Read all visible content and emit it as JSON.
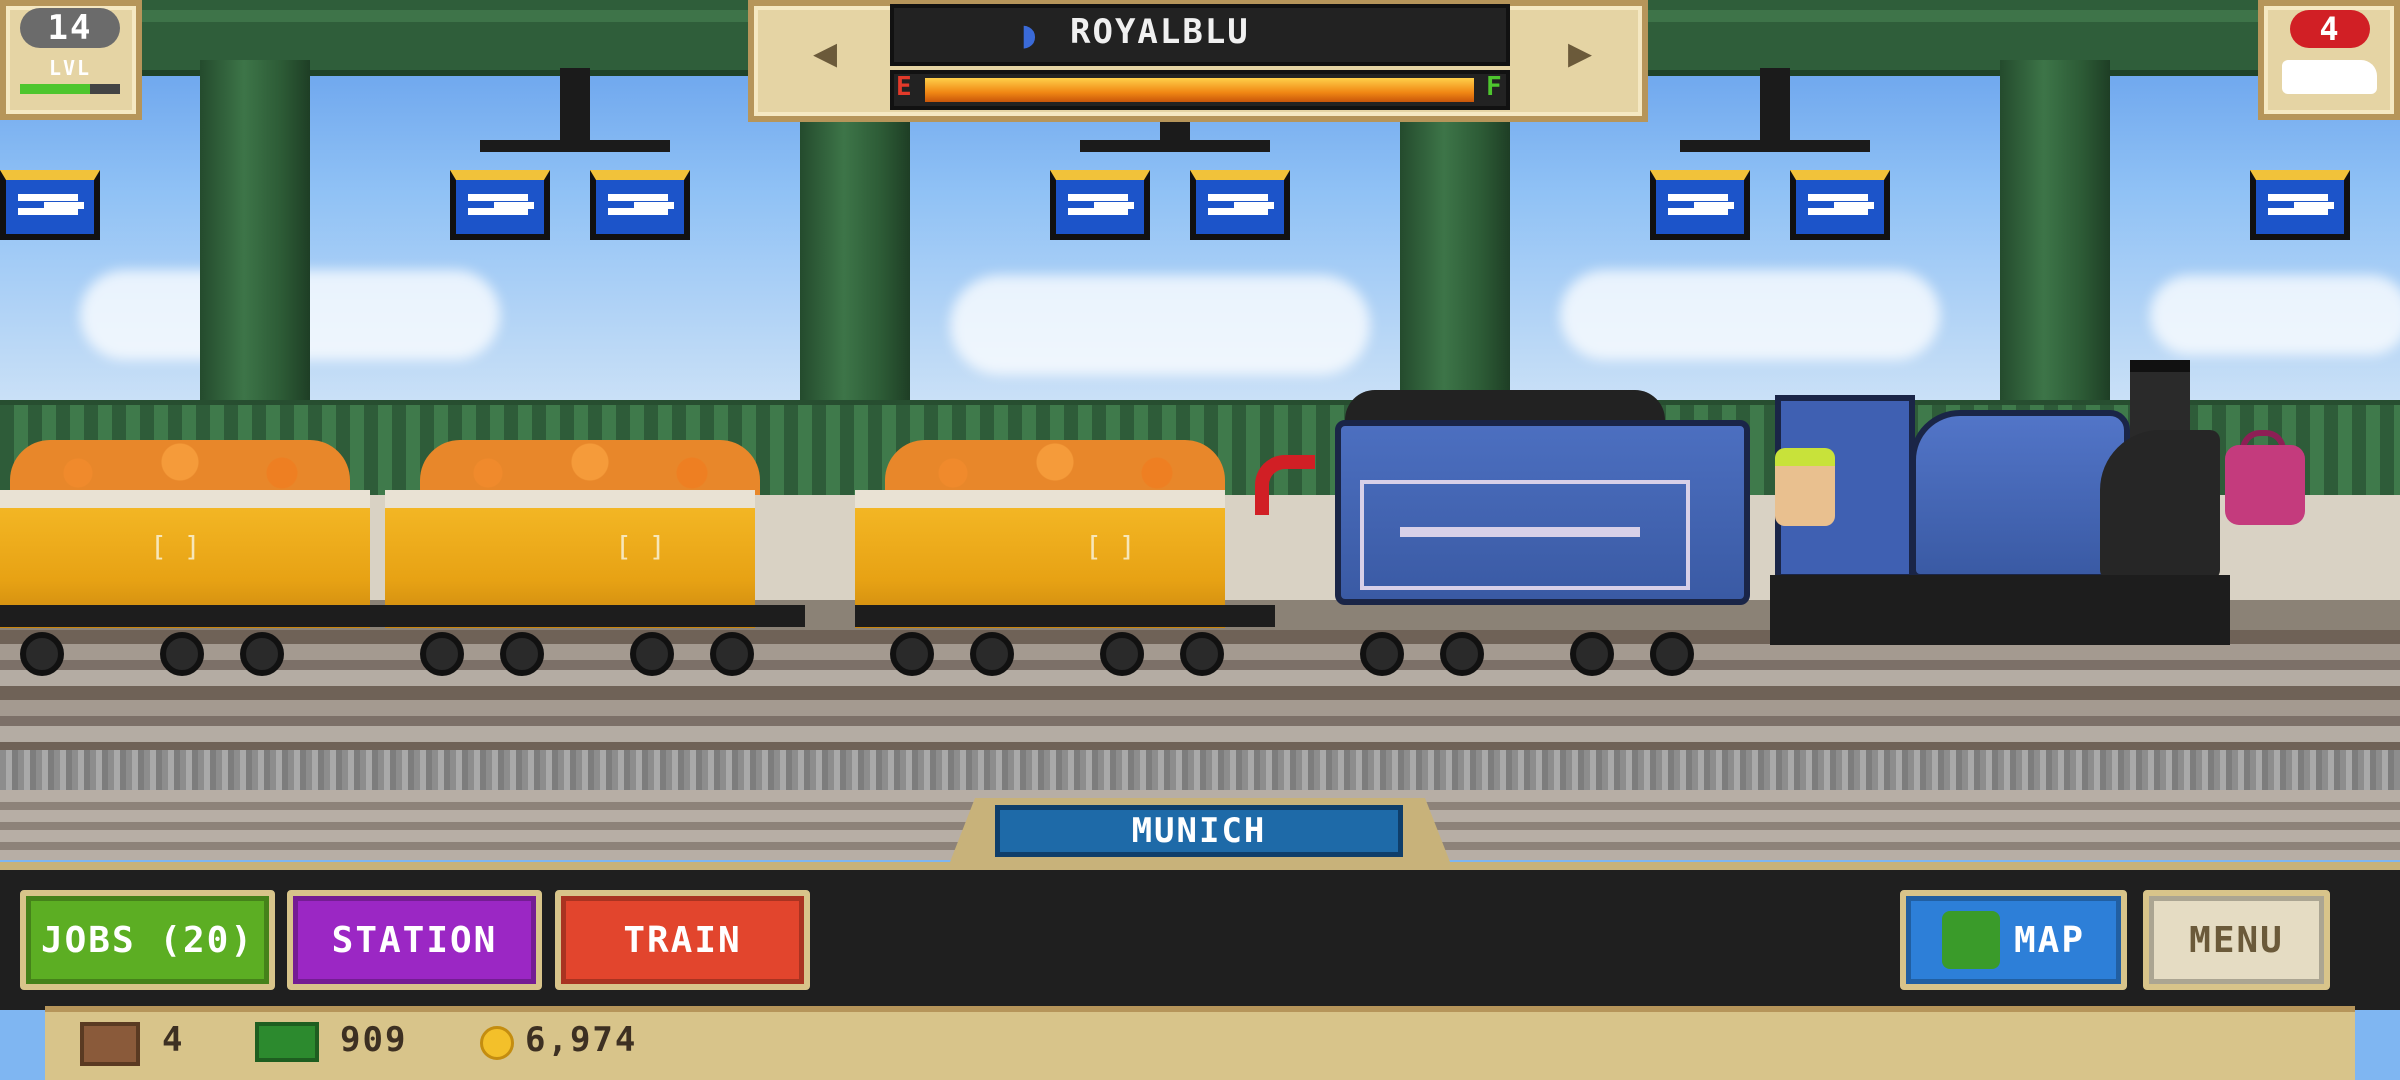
{
  "hud": {
    "level": "14",
    "level_label": "LVL",
    "level_progress": 0.7,
    "train_name": "ROYALBLU",
    "fuel_empty_label": "E",
    "fuel_full_label": "F",
    "fuel_level": 0.95,
    "trains_count": "4"
  },
  "station_name": "MUNICH",
  "buttons": {
    "jobs": "JOBS (20)",
    "station": "STATION",
    "train": "TRAIN",
    "map": "MAP",
    "menu": "MENU"
  },
  "resources": {
    "crates": "4",
    "cash": "909",
    "coins": "6,974"
  },
  "colors": {
    "jobs_button": "#5cae23",
    "station_button": "#9b27c4",
    "train_button": "#e2452d",
    "map_button": "#2d7fd8",
    "station_plate": "#1e6aa8"
  }
}
